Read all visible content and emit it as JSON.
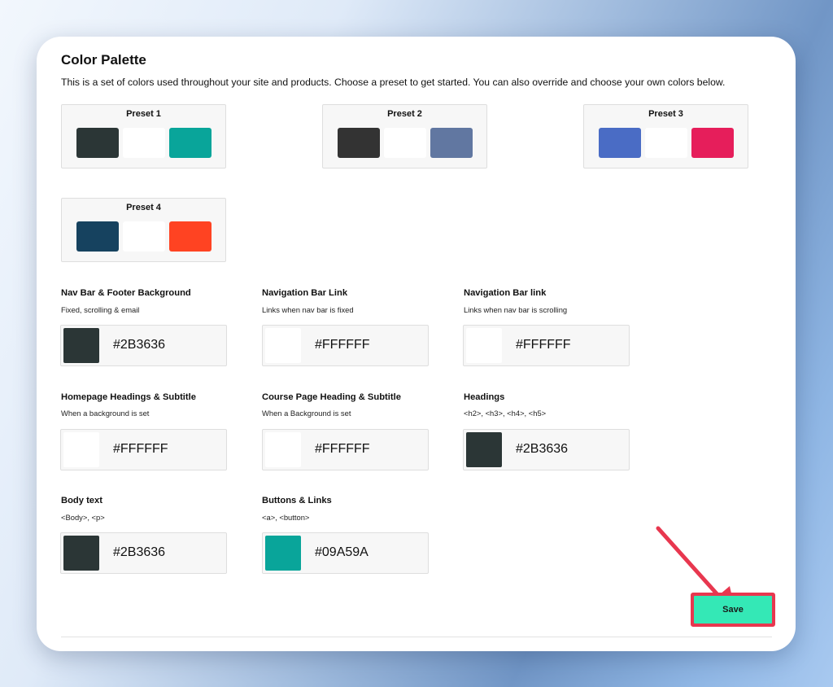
{
  "panel": {
    "title": "Color Palette",
    "description": "This is a set of colors used throughout your site and products. Choose a preset to get started. You can also override and choose your own colors below."
  },
  "presets": [
    {
      "label": "Preset 1",
      "colors": [
        "#2B3636",
        "#FFFFFF",
        "#09A59A"
      ]
    },
    {
      "label": "Preset 2",
      "colors": [
        "#333333",
        "#FFFFFF",
        "#6177A1"
      ]
    },
    {
      "label": "Preset 3",
      "colors": [
        "#4A6CC5",
        "#FFFFFF",
        "#E61E5B"
      ]
    },
    {
      "label": "Preset 4",
      "colors": [
        "#16425F",
        "#FFFFFF",
        "#FF4322"
      ]
    }
  ],
  "fields": [
    {
      "title": "Nav Bar & Footer Background",
      "subtitle": "Fixed, scrolling & email",
      "value": "#2B3636"
    },
    {
      "title": "Navigation Bar Link",
      "subtitle": "Links when nav bar is fixed",
      "value": "#FFFFFF"
    },
    {
      "title": "Navigation Bar link",
      "subtitle": "Links when nav bar is scrolling",
      "value": "#FFFFFF"
    },
    {
      "title": "Homepage Headings & Subtitle",
      "subtitle": "When a background is set",
      "value": "#FFFFFF"
    },
    {
      "title": "Course Page Heading & Subtitle",
      "subtitle": "When a Background is set",
      "value": "#FFFFFF"
    },
    {
      "title": "Headings",
      "subtitle": "<h2>, <h3>, <h4>, <h5>",
      "value": "#2B3636"
    },
    {
      "title": "Body text",
      "subtitle": "<Body>, <p>",
      "value": "#2B3636"
    },
    {
      "title": "Buttons & Links",
      "subtitle": "<a>, <button>",
      "value": "#09A59A"
    }
  ],
  "actions": {
    "save_label": "Save"
  },
  "accent_colors": {
    "save_button": "#34E8B6",
    "highlight": "#E8374F"
  }
}
